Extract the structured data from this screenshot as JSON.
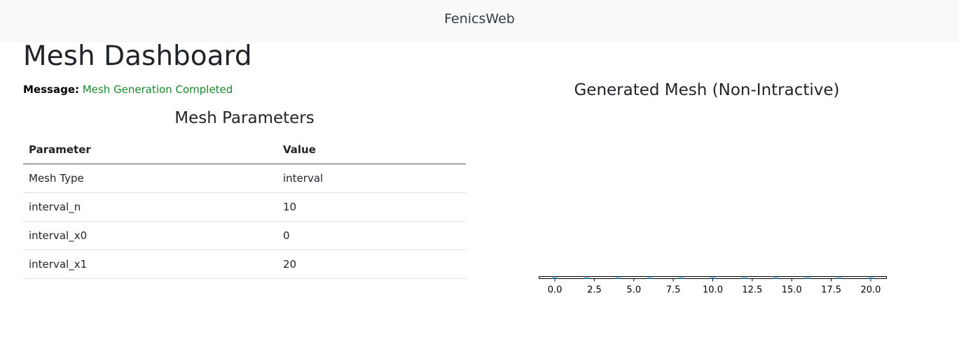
{
  "navbar": {
    "brand": "FenicsWeb"
  },
  "page": {
    "title": "Mesh Dashboard"
  },
  "message": {
    "label": "Message:",
    "text": "Mesh Generation Completed",
    "color": "#198a2f"
  },
  "parameters": {
    "title": "Mesh Parameters",
    "headers": [
      "Parameter",
      "Value"
    ],
    "rows": [
      [
        "Mesh Type",
        "interval"
      ],
      [
        "interval_n",
        "10"
      ],
      [
        "interval_x0",
        "0"
      ],
      [
        "interval_x1",
        "20"
      ]
    ]
  },
  "chart_data": {
    "type": "scatter",
    "title": "Generated Mesh (Non-Intractive)",
    "xlabel": "",
    "ylabel": "",
    "xlim": [
      -1,
      21
    ],
    "xticks": [
      0.0,
      2.5,
      5.0,
      7.5,
      10.0,
      12.5,
      15.0,
      17.5,
      20.0
    ],
    "xtick_labels": [
      "0.0",
      "2.5",
      "5.0",
      "7.5",
      "10.0",
      "12.5",
      "15.0",
      "17.5",
      "20.0"
    ],
    "series": [
      {
        "x": [
          0,
          2,
          4,
          6,
          8,
          10,
          12,
          14,
          16,
          18,
          20
        ],
        "y": [
          0,
          0,
          0,
          0,
          0,
          0,
          0,
          0,
          0,
          0,
          0
        ],
        "color": "#1f77b4"
      }
    ],
    "grid": false
  }
}
